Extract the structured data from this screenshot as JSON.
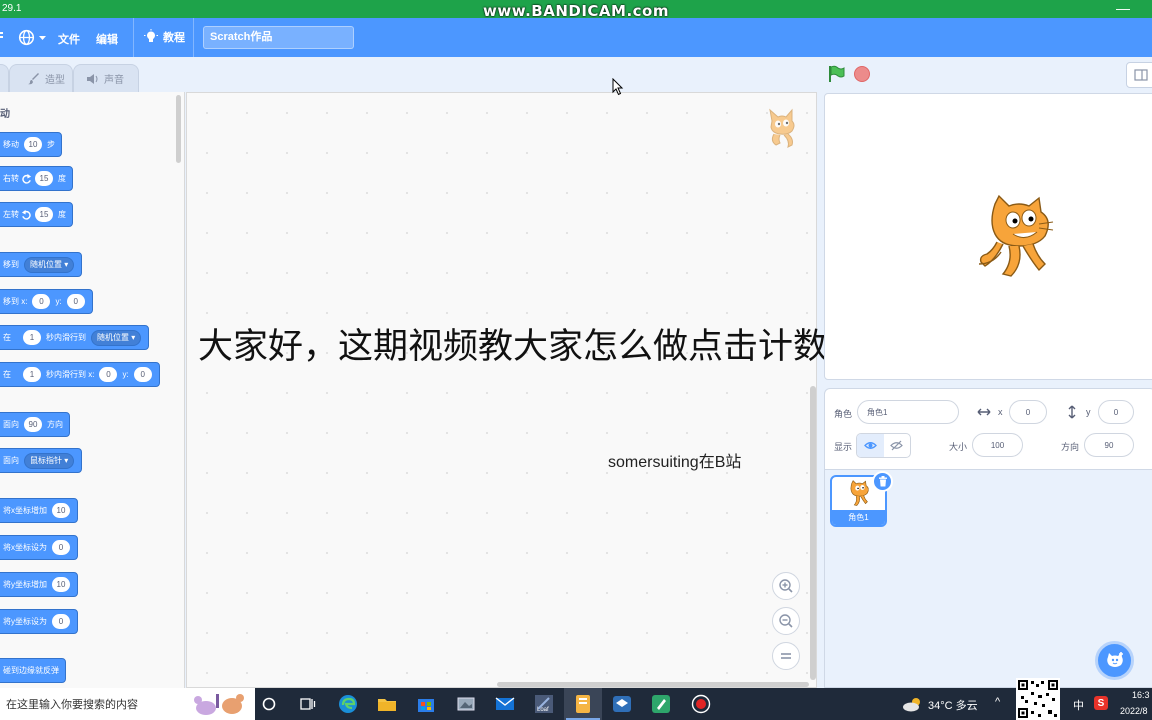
{
  "recorder": {
    "version": "29.1",
    "brand": "www.BANDICAM.com"
  },
  "menubar": {
    "file": "文件",
    "edit": "编辑",
    "tutorials": "教程",
    "project_title": "Scratch作品"
  },
  "tabs": {
    "costumes": "造型",
    "sounds": "声音"
  },
  "palette": {
    "category": "运动",
    "blocks": {
      "move": {
        "prefix": "移动",
        "value": "10",
        "suffix": "步"
      },
      "turn_right": {
        "prefix": "右转",
        "value": "15",
        "suffix": "度"
      },
      "turn_left": {
        "prefix": "左转",
        "value": "15",
        "suffix": "度"
      },
      "goto": {
        "prefix": "移到",
        "dropdown": "随机位置"
      },
      "goto_xy": {
        "prefix": "移到 x:",
        "x": "0",
        "ylabel": "y:",
        "y": "0"
      },
      "glide": {
        "prefix": "在",
        "value": "1",
        "mid": "秒内滑行到",
        "dropdown": "随机位置"
      },
      "glide_xy": {
        "prefix": "在",
        "value": "1",
        "mid": "秒内滑行到 x:",
        "x": "0",
        "ylabel": "y:",
        "y": "0"
      },
      "point_dir": {
        "prefix": "面向",
        "value": "90",
        "suffix": "方向"
      },
      "point_towards": {
        "prefix": "面向",
        "dropdown": "鼠标指针"
      },
      "change_x": {
        "prefix": "将x坐标增加",
        "value": "10"
      },
      "set_x": {
        "prefix": "将x坐标设为",
        "value": "0"
      },
      "change_y": {
        "prefix": "将y坐标增加",
        "value": "10"
      },
      "set_y": {
        "prefix": "将y坐标设为",
        "value": "0"
      },
      "bounce": {
        "prefix": "碰到边缘就反弹"
      }
    }
  },
  "overlay": {
    "title": "大家好，这期视频教大家怎么做点击计数器",
    "subtitle": "somersuiting在B站"
  },
  "sprite_info": {
    "sprite_label": "角色",
    "sprite_name": "角色1",
    "x_label": "x",
    "x_value": "0",
    "y_label": "y",
    "y_value": "0",
    "show_label": "显示",
    "size_label": "大小",
    "size_value": "100",
    "direction_label": "方向",
    "direction_value": "90"
  },
  "sprites": [
    {
      "name": "角色1"
    }
  ],
  "taskbar": {
    "search_placeholder": "在这里输入你要搜索的内容",
    "weather": "34°C 多云",
    "ime": "中",
    "time": "16:3",
    "date": "2022/8"
  },
  "colors": {
    "scratch_blue": "#4c97ff",
    "motion_block": "#4c97ff",
    "recorder_green": "#1ea34a",
    "flag_green": "#4cbf56",
    "stop_red": "#ec5959"
  }
}
